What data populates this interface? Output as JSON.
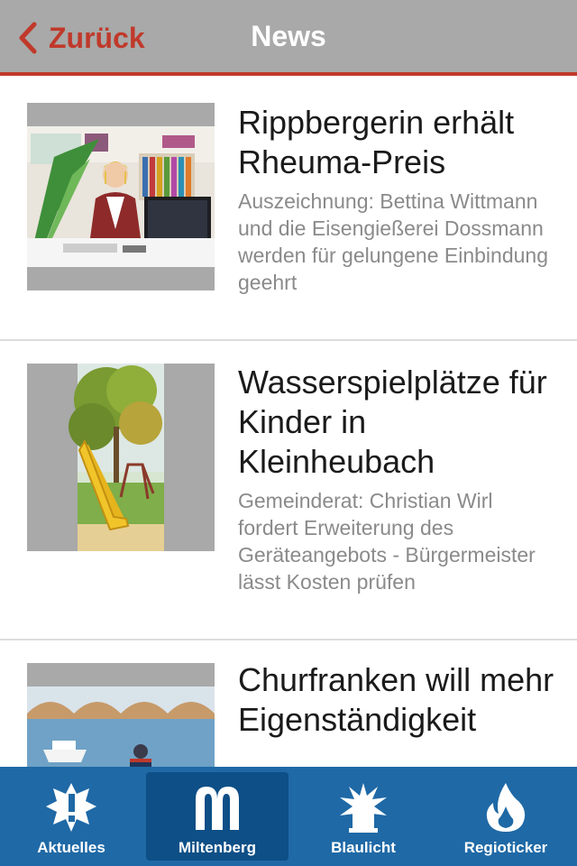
{
  "header": {
    "back_label": "Zurück",
    "title": "News",
    "accent_color": "#c0392b",
    "bg_color": "#a8a9a8"
  },
  "articles": [
    {
      "headline": "Rippbergerin erhält Rheuma-Preis",
      "teaser": "Auszeichnung: Bettina Wittmann und die Eisengießerei Dossmann werden für gelungene Einbindung geehrt",
      "image": "office-photo"
    },
    {
      "headline": "Wasserspielplätze für Kinder in Kleinheubach",
      "teaser": "Gemeinderat: Christian Wirl fordert Erweiterung des Geräteangebots - Bürgermeister lässt Kosten prüfen",
      "image": "playground-photo"
    },
    {
      "headline": "Churfranken will mehr Eigenständigkeit",
      "teaser": "",
      "image": "river-photo"
    }
  ],
  "tabbar": {
    "bg_color": "#1f69a6",
    "active_color": "#0d4f86",
    "tabs": [
      {
        "label": "Aktuelles",
        "icon": "alert-burst-icon",
        "active": false
      },
      {
        "label": "Miltenberg",
        "icon": "miltenberg-m-icon",
        "active": true
      },
      {
        "label": "Blaulicht",
        "icon": "siren-icon",
        "active": false
      },
      {
        "label": "Regioticker",
        "icon": "flame-icon",
        "active": false
      }
    ]
  }
}
